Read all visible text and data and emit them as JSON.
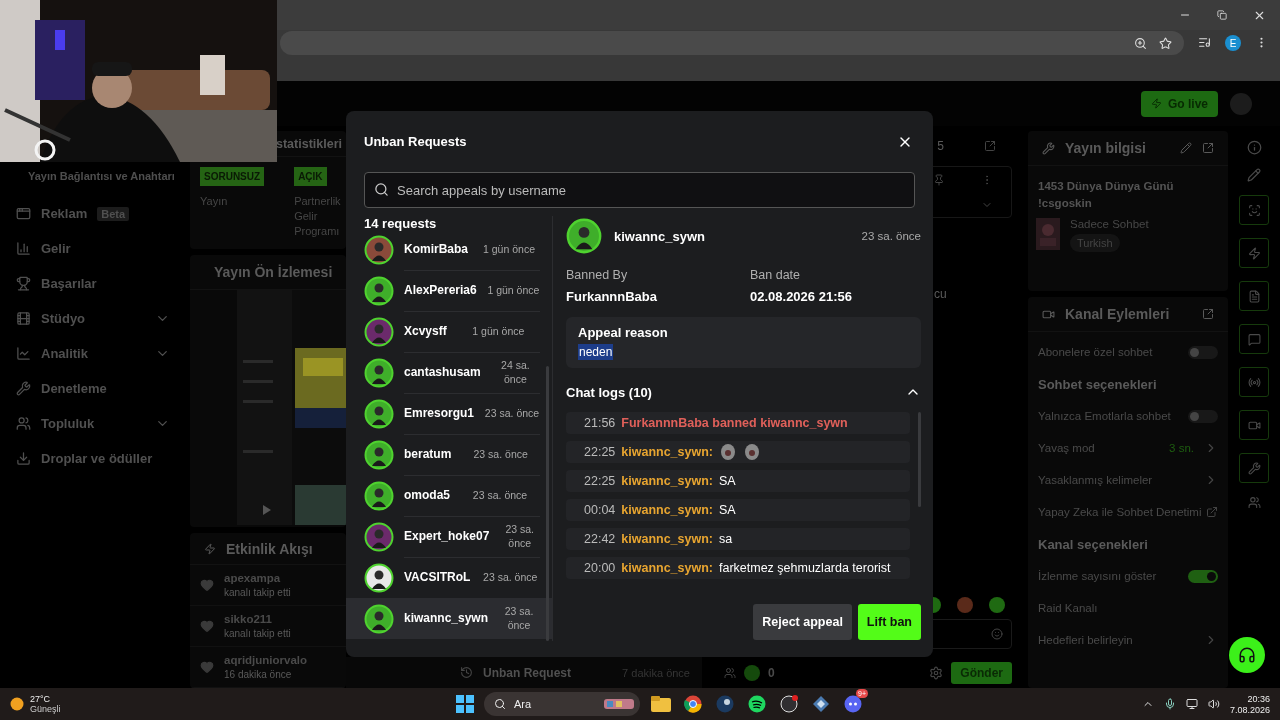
{
  "browser": {
    "profile_initial": "E"
  },
  "topbar": {
    "go_live": "Go live"
  },
  "sidebar": {
    "heading": "Yayın Bağlantısı ve Anahtarı",
    "items": [
      {
        "kind": "link",
        "label": "Reklam",
        "badge": "Beta"
      },
      {
        "kind": "link",
        "label": "Gelir"
      },
      {
        "kind": "link",
        "label": "Başarılar"
      },
      {
        "kind": "group",
        "label": "Stüdyo",
        "expanded": false
      },
      {
        "kind": "group",
        "label": "Analitik",
        "expanded": false
      },
      {
        "kind": "link",
        "label": "Denetleme"
      },
      {
        "kind": "group",
        "label": "Topluluk",
        "expanded": false
      },
      {
        "kind": "link",
        "label": "Droplar ve ödüller"
      }
    ]
  },
  "stats": {
    "title": "statistikleri",
    "items": [
      {
        "badge": "SORUNSUZ",
        "label": "Yayın"
      },
      {
        "badge": "AÇIK",
        "label": "Partnerlik Gelir Programı"
      }
    ]
  },
  "preview": {
    "title": "Yayın Ön İzlemesi"
  },
  "activity": {
    "title": "Etkinlik Akışı",
    "items": [
      {
        "user": "apexampa",
        "action": "kanalı takip etti"
      },
      {
        "user": "sikko211",
        "action": "kanalı takip etti"
      },
      {
        "user": "aqridjuniorvalo",
        "time": "16 dakika önce"
      }
    ]
  },
  "unban_notice": {
    "title": "Unban Request",
    "time": "7 dakika önce"
  },
  "chat": {
    "header_fragment": "5",
    "message_fragment": "cu",
    "count": "0",
    "send": "Gönder"
  },
  "stream_info": {
    "title": "Yayın bilgisi",
    "stream_title": "1453 Dünya Dünya Günü !csgoskin",
    "category": "Sadece Sohbet",
    "tag": "Turkish"
  },
  "channel_actions": {
    "title": "Kanal Eylemleri",
    "rows": [
      {
        "kind": "toggle",
        "label": "Abonelere özel sohbet",
        "on": false
      },
      {
        "kind": "heading",
        "label": "Sohbet seçenekleri"
      },
      {
        "kind": "toggle",
        "label": "Yalnızca Emotlarla sohbet",
        "on": false
      },
      {
        "kind": "nav",
        "label": "Yavaş mod",
        "value": "3 sn."
      },
      {
        "kind": "nav",
        "label": "Yasaklanmış kelimeler"
      },
      {
        "kind": "external",
        "label": "Yapay Zeka ile Sohbet Denetimi"
      },
      {
        "kind": "heading",
        "label": "Kanal seçenekleri"
      },
      {
        "kind": "toggle",
        "label": "İzlenme sayısını göster",
        "on": true
      },
      {
        "kind": "plain",
        "label": "Raid Kanalı"
      },
      {
        "kind": "nav",
        "label": "Hedefleri belirleyin"
      }
    ]
  },
  "modal": {
    "title": "Unban Requests",
    "search_placeholder": "Search appeals by username",
    "count": "14 requests",
    "requests": [
      {
        "name": "KomirBaba",
        "time": "1 gün önce",
        "color": "#8a4a3a",
        "selected": false
      },
      {
        "name": "AlexPereria6",
        "time": "1 gün önce",
        "color": "#3fae2a",
        "selected": false
      },
      {
        "name": "Xcvysff",
        "time": "1 gün önce",
        "color": "#6b2a6b",
        "selected": false
      },
      {
        "name": "cantashusam",
        "time": "24 sa. önce",
        "color": "#3fae2a",
        "selected": false
      },
      {
        "name": "Emresorgu1",
        "time": "23 sa. önce",
        "color": "#3fae2a",
        "selected": false
      },
      {
        "name": "beratum",
        "time": "23 sa. önce",
        "color": "#3fae2a",
        "selected": false
      },
      {
        "name": "omoda5",
        "time": "23 sa. önce",
        "color": "#3fae2a",
        "selected": false
      },
      {
        "name": "Expert_hoke07",
        "time": "23 sa. önce",
        "color": "#6b2a6b",
        "selected": false
      },
      {
        "name": "VACSITRoL",
        "time": "23 sa. önce",
        "color": "#e8e8e8",
        "selected": false
      },
      {
        "name": "kiwannc_sywn",
        "time": "23 sa. önce",
        "color": "#3fae2a",
        "selected": true
      }
    ],
    "detail": {
      "name": "kiwannc_sywn",
      "time": "23 sa. önce",
      "color": "#3fae2a",
      "banned_by_label": "Banned By",
      "banned_by": "FurkannnBaba",
      "ban_date_label": "Ban date",
      "ban_date": "02.08.2026 21:56",
      "reason_label": "Appeal reason",
      "reason": "neden",
      "logs_title": "Chat logs (10)",
      "logs_expanded": true,
      "logs": [
        {
          "kind": "ban",
          "time": "21:56",
          "text": "FurkannnBaba banned kiwannc_sywn"
        },
        {
          "kind": "emotes",
          "time": "22:25",
          "user": "kiwannc_sywn:"
        },
        {
          "kind": "message",
          "time": "22:25",
          "user": "kiwannc_sywn:",
          "text": "SA"
        },
        {
          "kind": "message",
          "time": "00:04",
          "user": "kiwannc_sywn:",
          "text": "SA"
        },
        {
          "kind": "message",
          "time": "22:42",
          "user": "kiwannc_sywn:",
          "text": "sa"
        },
        {
          "kind": "message",
          "time": "20:00",
          "user": "kiwannc_sywn:",
          "text": "farketmez şehmuzlarda terorist"
        }
      ]
    },
    "buttons": {
      "reject": "Reject appeal",
      "approve": "Lift ban"
    }
  },
  "taskbar": {
    "temperature": "27°C",
    "weather": "Güneşli",
    "search_placeholder": "Ara",
    "discord_badge": "9+",
    "time": "20:36",
    "date": "7.08.2026"
  }
}
